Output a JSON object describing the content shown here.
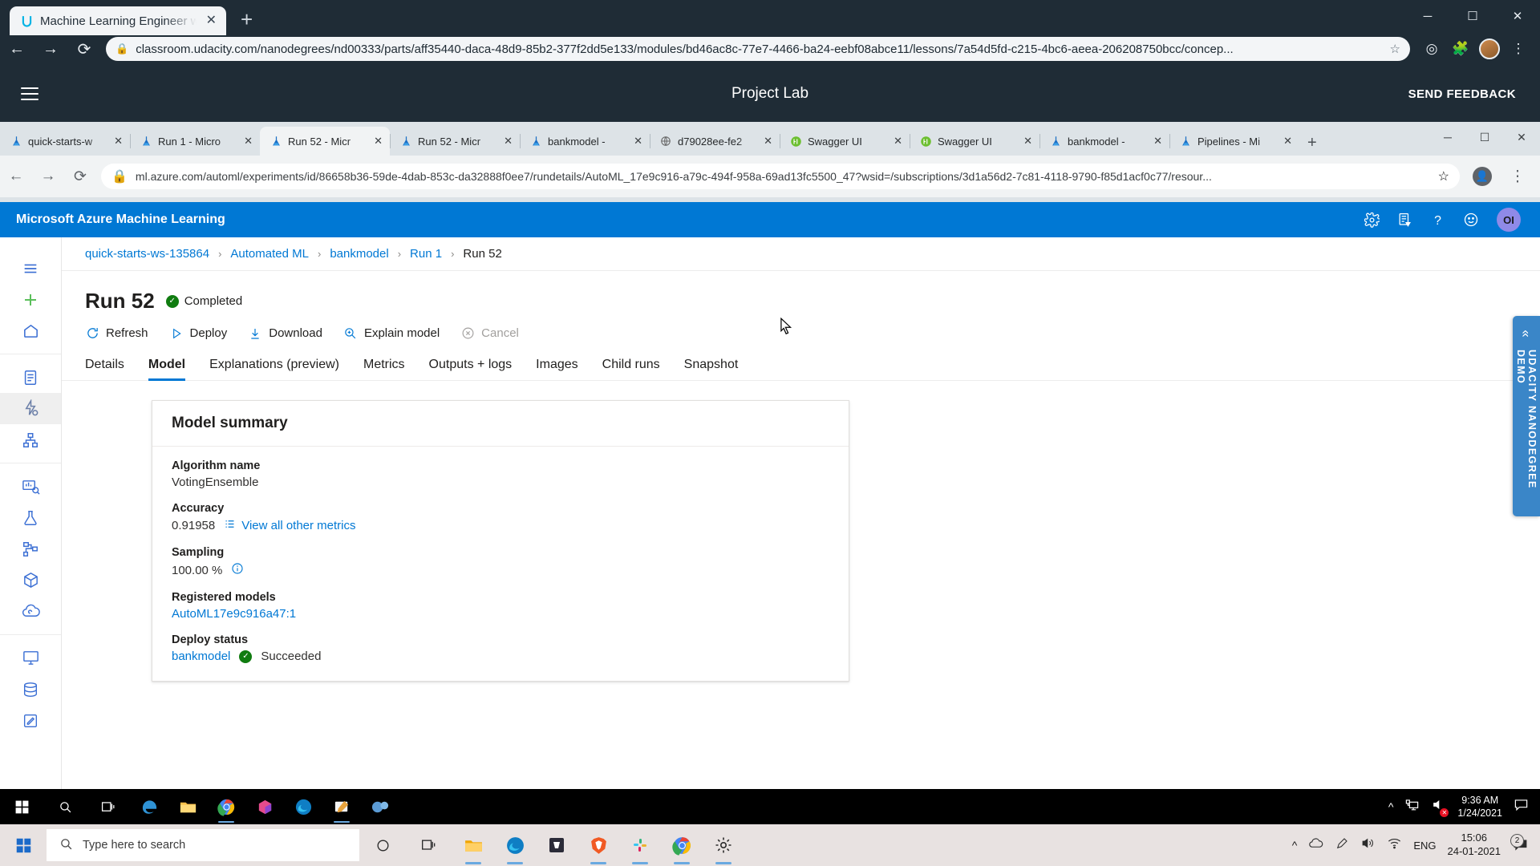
{
  "outer_browser": {
    "tab": {
      "title": "Machine Learning Engineer with ",
      "favicon": "udacity-icon",
      "close_label": "✕"
    },
    "new_tab_label": "+",
    "window_controls": {
      "minimize": "─",
      "maximize": "☐",
      "close": "✕"
    },
    "nav": {
      "back": "←",
      "forward": "→",
      "reload": "⟳"
    },
    "url": "classroom.udacity.com/nanodegrees/nd00333/parts/aff35440-daca-48d9-85b2-377f2dd5e133/modules/bd46ac8c-77e7-4466-ba24-eebf08abce11/lessons/7a54d5fd-c215-4bc6-aeea-206208750bcc/concep...",
    "lock_icon": "lock-icon",
    "star_icon": "bookmark-star-icon"
  },
  "lab_bar": {
    "menu_icon": "hamburger-menu-icon",
    "title": "Project Lab",
    "feedback_label": "SEND FEEDBACK"
  },
  "inner_browser": {
    "tabs": [
      {
        "title": "quick-starts-w",
        "favicon": "azure-ml-icon",
        "active": false
      },
      {
        "title": "Run 1 - Micro",
        "favicon": "azure-ml-icon",
        "active": false
      },
      {
        "title": "Run 52 - Micr",
        "favicon": "azure-ml-icon",
        "active": true
      },
      {
        "title": "Run 52 - Micr",
        "favicon": "azure-ml-icon",
        "active": false
      },
      {
        "title": "bankmodel - ",
        "favicon": "azure-ml-icon",
        "active": false
      },
      {
        "title": "d79028ee-fe2",
        "favicon": "globe-icon",
        "active": false
      },
      {
        "title": "Swagger UI",
        "favicon": "swagger-icon",
        "active": false
      },
      {
        "title": "Swagger UI",
        "favicon": "swagger-icon",
        "active": false
      },
      {
        "title": "bankmodel - ",
        "favicon": "azure-ml-icon",
        "active": false
      },
      {
        "title": "Pipelines - Mi",
        "favicon": "azure-ml-icon",
        "active": false
      }
    ],
    "close_label": "✕",
    "new_tab_label": "+",
    "window_controls": {
      "minimize": "─",
      "maximize": "☐",
      "close": "✕"
    },
    "nav": {
      "back": "←",
      "forward": "→",
      "reload": "⟳"
    },
    "url": "ml.azure.com/automl/experiments/id/86658b36-59de-4dab-853c-da32888f0ee7/rundetails/AutoML_17e9c916-a79c-494f-958a-69ad13fc5500_47?wsid=/subscriptions/3d1a56d2-7c81-4118-9790-f85d1acf0c77/resour...",
    "lock_icon": "lock-icon",
    "star_icon": "bookmark-star-icon",
    "profile_icon": "profile-avatar-icon",
    "menu_icon": "chrome-menu-icon"
  },
  "azure_header": {
    "brand": "Microsoft Azure Machine Learning",
    "icons": [
      "gear-icon",
      "feedback-note-icon",
      "help-question-icon",
      "smiley-icon"
    ],
    "user_initials": "OI"
  },
  "sidebar": {
    "groups": [
      {
        "items": [
          {
            "name": "hamburger-menu-icon",
            "selected": false
          },
          {
            "name": "new-plus-icon",
            "selected": false
          },
          {
            "name": "home-icon",
            "selected": false
          }
        ]
      },
      {
        "items": [
          {
            "name": "notebooks-icon",
            "selected": false
          },
          {
            "name": "automated-ml-icon",
            "selected": true
          },
          {
            "name": "designer-icon",
            "selected": false
          }
        ]
      },
      {
        "items": [
          {
            "name": "datasets-icon",
            "selected": false
          },
          {
            "name": "experiments-flask-icon",
            "selected": false
          },
          {
            "name": "pipelines-icon",
            "selected": false
          },
          {
            "name": "models-cube-icon",
            "selected": false
          },
          {
            "name": "endpoints-cloud-icon",
            "selected": false
          }
        ]
      },
      {
        "items": [
          {
            "name": "compute-monitor-icon",
            "selected": false
          },
          {
            "name": "datastores-icon",
            "selected": false
          },
          {
            "name": "labeling-icon",
            "selected": false
          }
        ]
      }
    ]
  },
  "breadcrumb": [
    {
      "label": "quick-starts-ws-135864",
      "link": true
    },
    {
      "label": "Automated ML",
      "link": true
    },
    {
      "label": "bankmodel",
      "link": true
    },
    {
      "label": "Run 1",
      "link": true
    },
    {
      "label": "Run 52",
      "link": false
    }
  ],
  "breadcrumb_separator": "›",
  "run": {
    "title": "Run 52",
    "status": "Completed",
    "status_icon": "check-circle-icon"
  },
  "commands": [
    {
      "label": "Refresh",
      "icon": "refresh-icon",
      "disabled": false
    },
    {
      "label": "Deploy",
      "icon": "play-triangle-icon",
      "disabled": false
    },
    {
      "label": "Download",
      "icon": "download-arrow-icon",
      "disabled": false
    },
    {
      "label": "Explain model",
      "icon": "magnifier-plus-icon",
      "disabled": false
    },
    {
      "label": "Cancel",
      "icon": "cancel-circle-icon",
      "disabled": true
    }
  ],
  "tabs": [
    {
      "label": "Details",
      "active": false
    },
    {
      "label": "Model",
      "active": true
    },
    {
      "label": "Explanations (preview)",
      "active": false
    },
    {
      "label": "Metrics",
      "active": false
    },
    {
      "label": "Outputs + logs",
      "active": false
    },
    {
      "label": "Images",
      "active": false
    },
    {
      "label": "Child runs",
      "active": false
    },
    {
      "label": "Snapshot",
      "active": false
    }
  ],
  "model_summary": {
    "heading": "Model summary",
    "algorithm_label": "Algorithm name",
    "algorithm_value": "VotingEnsemble",
    "accuracy_label": "Accuracy",
    "accuracy_value": "0.91958",
    "view_metrics_label": "View all other metrics",
    "view_metrics_icon": "list-icon",
    "sampling_label": "Sampling",
    "sampling_value": "100.00 %",
    "sampling_info_icon": "info-circle-icon",
    "registered_models_label": "Registered models",
    "registered_models_value": "AutoML17e9c916a47:1",
    "deploy_status_label": "Deploy status",
    "deploy_name": "bankmodel",
    "deploy_status": "Succeeded",
    "deploy_status_icon": "check-circle-icon"
  },
  "udacity_panel": {
    "collapse_icon": "double-chevron-icon",
    "text": "UDACITY NANODEGREE DEMO"
  },
  "inner_taskbar": {
    "start_icon": "windows-start-icon",
    "search_icon": "search-icon",
    "taskview_icon": "task-view-icon",
    "apps": [
      {
        "name": "edge-legacy-icon",
        "running": false
      },
      {
        "name": "file-explorer-icon",
        "running": false
      },
      {
        "name": "chrome-icon",
        "running": true
      },
      {
        "name": "paint3d-icon",
        "running": false
      },
      {
        "name": "edge-chromium-icon",
        "running": false
      },
      {
        "name": "snip-sketch-icon",
        "running": true
      },
      {
        "name": "teams-icon",
        "running": false
      }
    ],
    "tray": {
      "chevron": "show-hidden-icon",
      "network": "network-icon",
      "volume": "volume-muted-icon",
      "action_center": "action-center-icon"
    },
    "clock_time": "9:36 AM",
    "clock_date": "1/24/2021"
  },
  "outer_taskbar": {
    "start_icon": "windows-start-icon",
    "search_placeholder": "Type here to search",
    "search_icon": "search-icon",
    "cortana_icon": "cortana-circle-icon",
    "taskview_icon": "task-view-icon",
    "apps": [
      {
        "name": "file-explorer-icon",
        "running": true
      },
      {
        "name": "edge-chromium-icon",
        "running": true
      },
      {
        "name": "microsoft-store-icon",
        "running": false
      },
      {
        "name": "brave-icon",
        "running": true
      },
      {
        "name": "slack-icon",
        "running": true
      },
      {
        "name": "chrome-icon",
        "running": true
      },
      {
        "name": "settings-gear-icon",
        "running": true
      }
    ],
    "tray": {
      "chevron": "show-hidden-icon",
      "onedrive": "onedrive-icon",
      "pen": "pen-icon",
      "volume": "volume-icon",
      "wifi": "wifi-icon"
    },
    "language": "ENG",
    "clock_time": "15:06",
    "clock_date": "24-01-2021",
    "notification_count": "2"
  },
  "colors": {
    "azure_blue": "#0078d4",
    "brave_dark": "#1f2c36",
    "udacity_panel": "#3a86c8",
    "success_green": "#107c10",
    "link_blue": "#0078d4"
  }
}
